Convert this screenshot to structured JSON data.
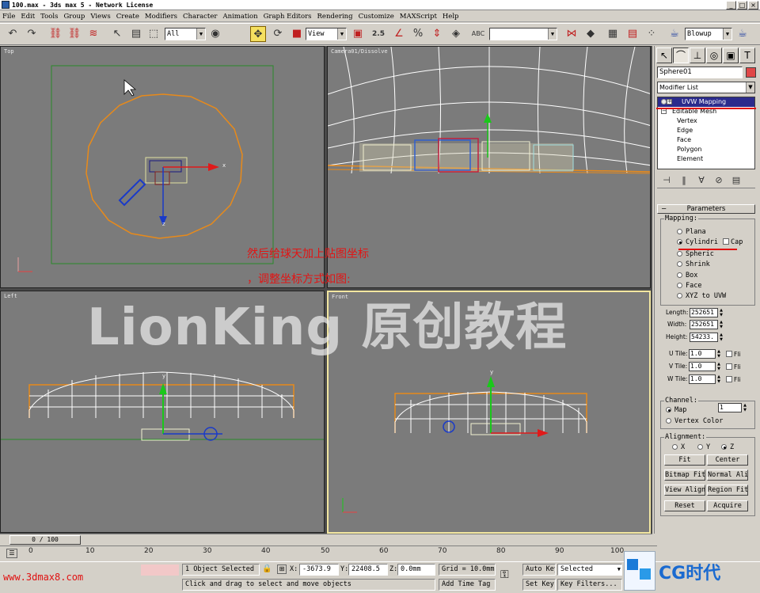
{
  "window": {
    "title": "100.max - 3ds max 5 - Network License",
    "buttons": [
      "_",
      "□",
      "×"
    ]
  },
  "menu": [
    "File",
    "Edit",
    "Tools",
    "Group",
    "Views",
    "Create",
    "Modifiers",
    "Character",
    "Animation",
    "Graph Editors",
    "Rendering",
    "Customize",
    "MAXScript",
    "Help"
  ],
  "toolbar": {
    "selection_filter": "All",
    "reference_coord": "View",
    "snap_value": "2.5",
    "render_type": "Blowup"
  },
  "viewports": {
    "top": "Top",
    "camera": "Camera01/Dissolve",
    "left": "Left",
    "front": "Front",
    "axis_x": "x",
    "axis_y": "y",
    "axis_z": "z"
  },
  "annotation": {
    "line1": "然后给球天加上贴图坐标",
    "line2": "，调整坐标方式如图:",
    "watermark": "LionKing 原创教程"
  },
  "command_panel": {
    "object_name": "Sphere01",
    "object_color": "#e04848",
    "modifier_list": "Modifier List",
    "stack": [
      "UVW Mapping",
      "Editable Mesh",
      "Vertex",
      "Edge",
      "Face",
      "Polygon",
      "Element"
    ],
    "rollout_title": "Parameters",
    "mapping_label": "Mapping:",
    "mapping_options": [
      "Planar",
      "Cylindrical",
      "Spherical",
      "Shrink Wrap",
      "Box",
      "Face",
      "XYZ to UVW"
    ],
    "mapping_selected": "Cylindrical",
    "mapping_labels": [
      "Plana",
      "Cylindri",
      "Spheric",
      "Shrink",
      "Box",
      "Face",
      "XYZ to UVW"
    ],
    "cap_label": "Cap",
    "length_label": "Length:",
    "length_value": "252651",
    "width_label": "Width:",
    "width_value": "252651",
    "height_label": "Height:",
    "height_value": "54233.",
    "utile_label": "U Tile:",
    "utile_value": "1.0",
    "vtile_label": "V Tile:",
    "vtile_value": "1.0",
    "wtile_label": "W Tile:",
    "wtile_value": "1.0",
    "flip_label": "Fli",
    "channel_label": "Channel:",
    "map_label": "Map",
    "map_channel": "1",
    "vertex_color_label": "Vertex Color",
    "alignment_label": "Alignment:",
    "axis_x": "X",
    "axis_y": "Y",
    "axis_z": "Z",
    "btn_fit": "Fit",
    "btn_center": "Center",
    "btn_bitmap_fit": "Bitmap Fit",
    "btn_normal_align": "Normal Align",
    "btn_view_align": "View Align",
    "btn_region_fit": "Region Fit",
    "btn_reset": "Reset",
    "btn_acquire": "Acquire"
  },
  "timeline": {
    "frame": "0 / 100",
    "ticks": [
      "0",
      "10",
      "20",
      "30",
      "40",
      "50",
      "60",
      "70",
      "80",
      "90",
      "100"
    ]
  },
  "status": {
    "url": "www.3dmax8.com",
    "selection": "1 Object Selected",
    "x_label": "X:",
    "x_value": "-3673.9",
    "y_label": "Y:",
    "y_value": "22408.5",
    "z_label": "Z:",
    "z_value": "0.0mm",
    "grid": "Grid = 10.0mm",
    "prompt": "Click and drag to select and move objects",
    "add_time_tag": "Add Time Tag",
    "auto_key": "Auto Key",
    "set_key": "Set Key",
    "key_filter": "Selected",
    "key_filters_btn": "Key Filters...",
    "logo": "CG时代"
  }
}
